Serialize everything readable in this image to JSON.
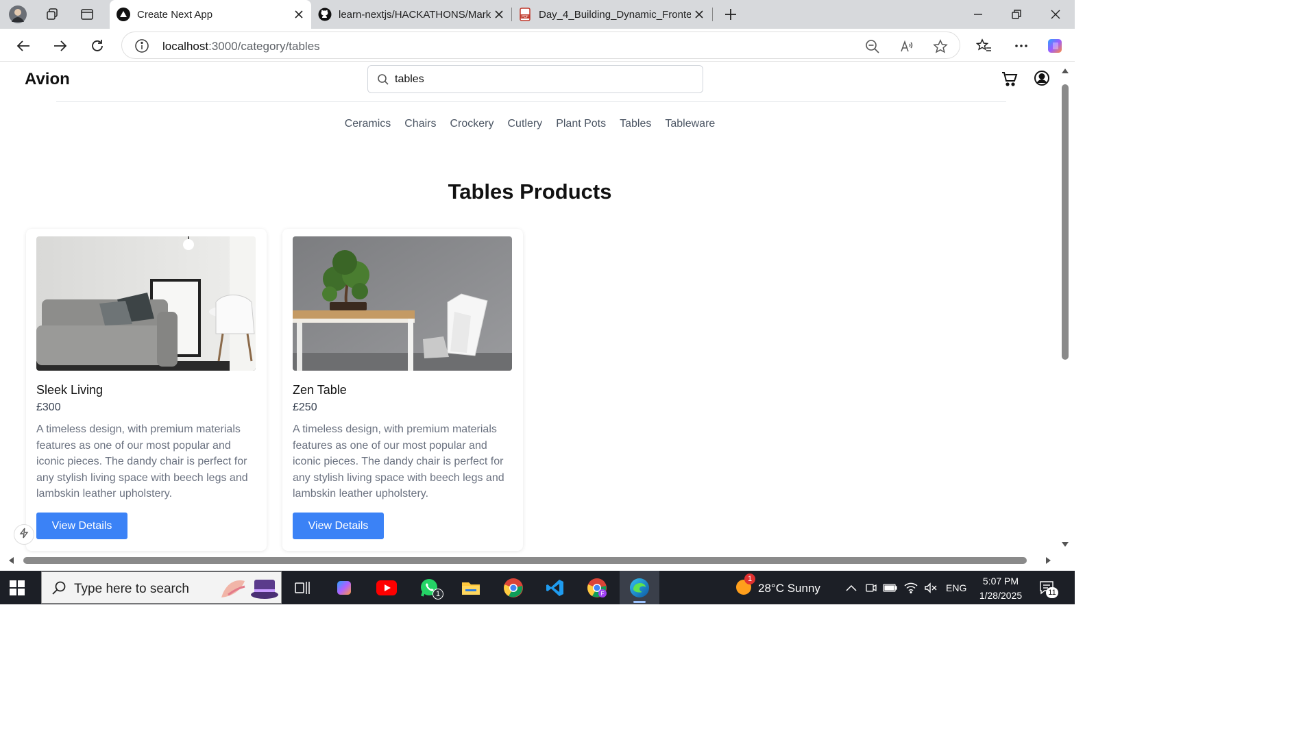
{
  "browser": {
    "tabs": [
      {
        "title": "Create Next App",
        "icon": "nextjs-icon",
        "active": true
      },
      {
        "title": "learn-nextjs/HACKATHONS/Marke",
        "icon": "github-icon",
        "active": false
      },
      {
        "title": "Day_4_Building_Dynamic_Fronten",
        "icon": "pdf-icon",
        "active": false
      }
    ],
    "url_host": "localhost",
    "url_path": ":3000/category/tables"
  },
  "site": {
    "logo": "Avion",
    "search": {
      "value": "tables",
      "placeholder": ""
    },
    "categories": [
      "Ceramics",
      "Chairs",
      "Crockery",
      "Cutlery",
      "Plant Pots",
      "Tables",
      "Tableware"
    ],
    "page_title": "Tables Products",
    "products": [
      {
        "name": "Sleek Living",
        "price": "£300",
        "description": "A timeless design, with premium materials features as one of our most popular and iconic pieces. The dandy chair is perfect for any stylish living space with beech legs and lambskin leather upholstery.",
        "button": "View Details",
        "image": "sofa-living-room-photo"
      },
      {
        "name": "Zen Table",
        "price": "£250",
        "description": "A timeless design, with premium materials features as one of our most popular and iconic pieces. The dandy chair is perfect for any stylish living space with beech legs and lambskin leather upholstery.",
        "button": "View Details",
        "image": "bonsai-table-photo"
      }
    ]
  },
  "taskbar": {
    "search_placeholder": "Type here to search",
    "whatsapp_badge": "1",
    "weather_badge": "1",
    "weather": "28°C  Sunny",
    "lang": "ENG",
    "time": "5:07 PM",
    "date": "1/28/2025",
    "notifications": "11"
  },
  "colors": {
    "accent": "#3b82f6",
    "tabbar": "#d7d9dc",
    "taskbar": "#1c1f26"
  }
}
